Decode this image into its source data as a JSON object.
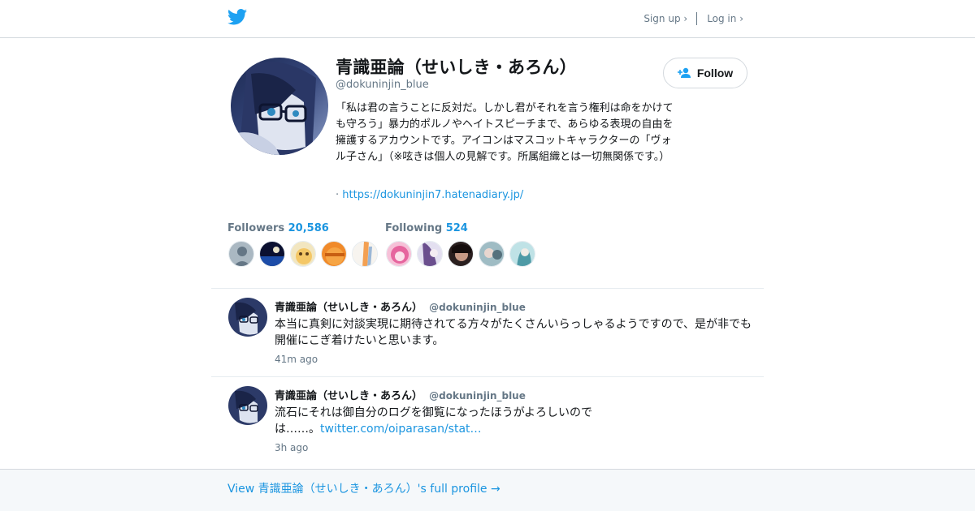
{
  "colors": {
    "accent": "#1b95e0",
    "muted": "#657786",
    "text": "#14171a"
  },
  "nav": {
    "signup": "Sign up ›",
    "login": "Log in ›",
    "logo_icon": "twitter-bird-icon"
  },
  "profile": {
    "name": "青識亜論（せいしき・あろん）",
    "handle": "@dokuninjin_blue",
    "bio": "「私は君の言うことに反対だ。しかし君がそれを言う権利は命をかけても守ろう」暴力的ポルノやヘイトスピーチまで、あらゆる表現の自由を擁護するアカウントです。アイコンはマスコットキャラクターの「ヴォル子さん」（※呟きは個人の見解です。所属組織とは一切無関係です。）",
    "url_prefix": "·",
    "url": "https://dokuninjin7.hatenadiary.jp/",
    "follow_label": "Follow"
  },
  "followers": {
    "label": "Followers",
    "count": "20,586"
  },
  "following": {
    "label": "Following",
    "count": "524"
  },
  "tweets": [
    {
      "name": "青識亜論（せいしき・あろん）",
      "handle": "@dokuninjin_blue",
      "text": "本当に真剣に対談実現に期待されてる方々がたくさんいらっしゃるようですので、是が非でも開催にこぎ着けたいと思います。",
      "time": "41m ago"
    },
    {
      "name": "青識亜論（せいしき・あろん）",
      "handle": "@dokuninjin_blue",
      "text": "流石にそれは御自分のログを御覧になったほうがよろしいのでは……。",
      "link": "twitter.com/oiparasan/stat…",
      "time": "3h ago"
    }
  ],
  "footer": {
    "view_profile": "View 青識亜論（せいしき・あろん）'s full profile →"
  }
}
